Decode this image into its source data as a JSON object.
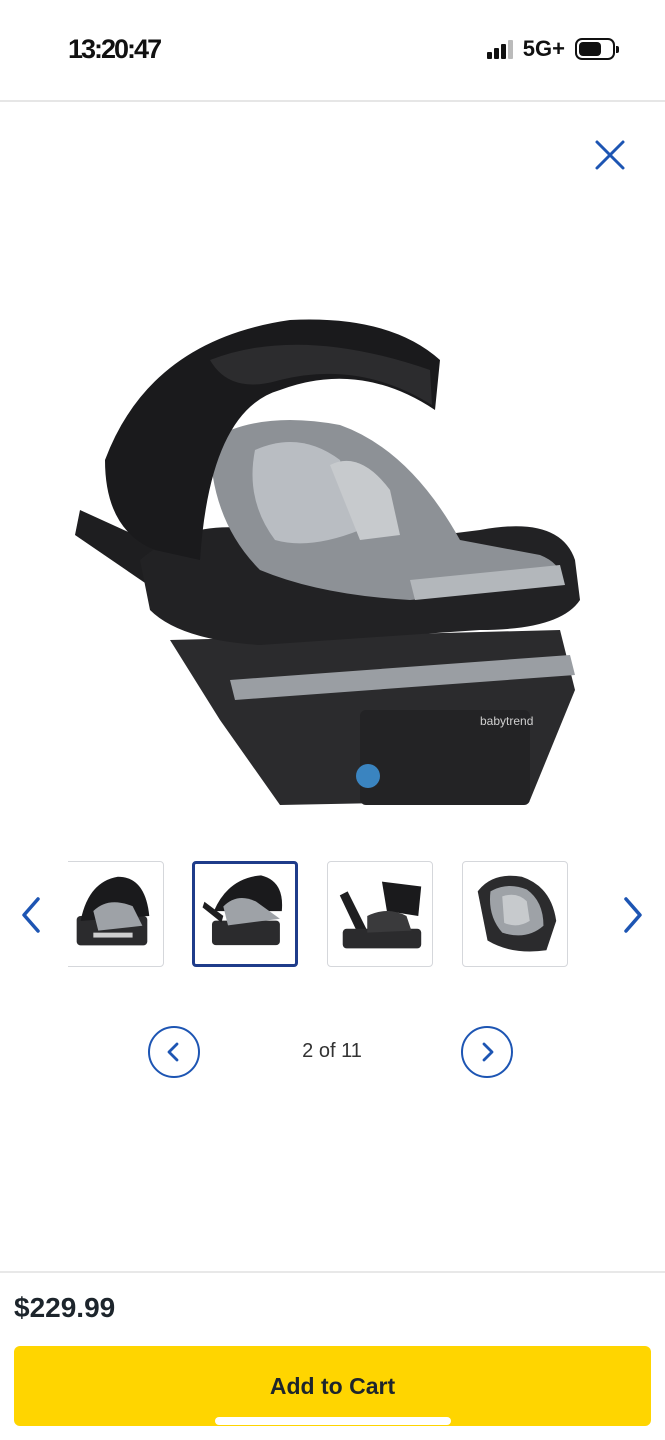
{
  "status_bar": {
    "time": "13:20:47",
    "network": "5G+",
    "icons": [
      "signal-icon",
      "battery-icon"
    ]
  },
  "modal": {
    "close_icon": "close-icon"
  },
  "main_image": {
    "brand_text": "babytrend"
  },
  "thumbnails": {
    "prev_icon": "chevron-left-icon",
    "next_icon": "chevron-right-icon",
    "selected_index": 2
  },
  "pager": {
    "current": "2 of 11",
    "prev_icon": "chevron-left-icon",
    "next_icon": "chevron-right-icon"
  },
  "footer": {
    "price": "$229.99",
    "add_to_cart_label": "Add to Cart"
  },
  "colors": {
    "accent_blue": "#1d55b3",
    "selected_border": "#1f3c8a",
    "cta_yellow": "#ffd500",
    "text": "#1d252c"
  }
}
